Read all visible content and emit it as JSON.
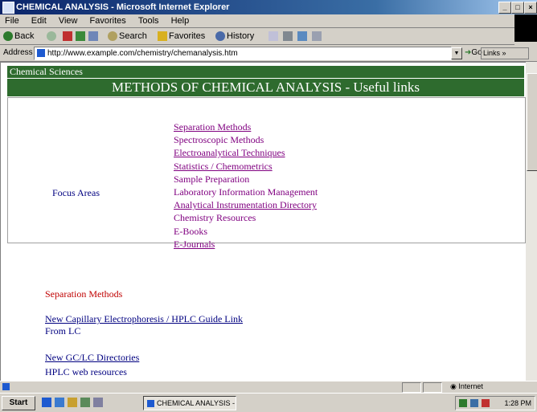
{
  "window": {
    "title": "CHEMICAL ANALYSIS - Microsoft Internet Explorer"
  },
  "menu": [
    "File",
    "Edit",
    "View",
    "Favorites",
    "Tools",
    "Help"
  ],
  "toolbar": {
    "back": "Back",
    "search": "Search",
    "favorites": "Favorites",
    "history": "History"
  },
  "address": {
    "label": "Address",
    "url": "http://www.example.com/chemistry/chemanalysis.htm",
    "go": "Go",
    "links": "Links"
  },
  "page": {
    "breadcrumb": "Chemical Sciences",
    "banner": "METHODS OF CHEMICAL ANALYSIS - Useful links",
    "focus_label": "Focus Areas",
    "links": [
      {
        "label": "Separation Methods",
        "underline": true
      },
      {
        "label": "Spectroscopic Methods",
        "underline": false
      },
      {
        "label": "Electroanalytical Techniques",
        "underline": true
      },
      {
        "label": "Statistics / Chemometrics",
        "underline": true
      },
      {
        "label": "Sample Preparation",
        "underline": false
      },
      {
        "label": "Laboratory Information Management",
        "underline": false
      },
      {
        "label": "Analytical Instrumentation Directory",
        "underline": true
      },
      {
        "label": "Chemistry Resources",
        "underline": false
      },
      {
        "label": "E-Books",
        "underline": false
      },
      {
        "label": "E-Journals",
        "underline": true
      }
    ],
    "section_title": "Separation Methods",
    "section_items": [
      {
        "link": "New Capillary Electrophoresis / HPLC Guide Link",
        "note": "From LC"
      },
      {
        "link": "New GC/LC Directories",
        "note": "HPLC web resources"
      }
    ]
  },
  "status": {
    "zone": "Internet"
  },
  "taskbar": {
    "start": "Start",
    "task_button": "CHEMICAL ANALYSIS - ...",
    "clock": "1:28 PM"
  }
}
